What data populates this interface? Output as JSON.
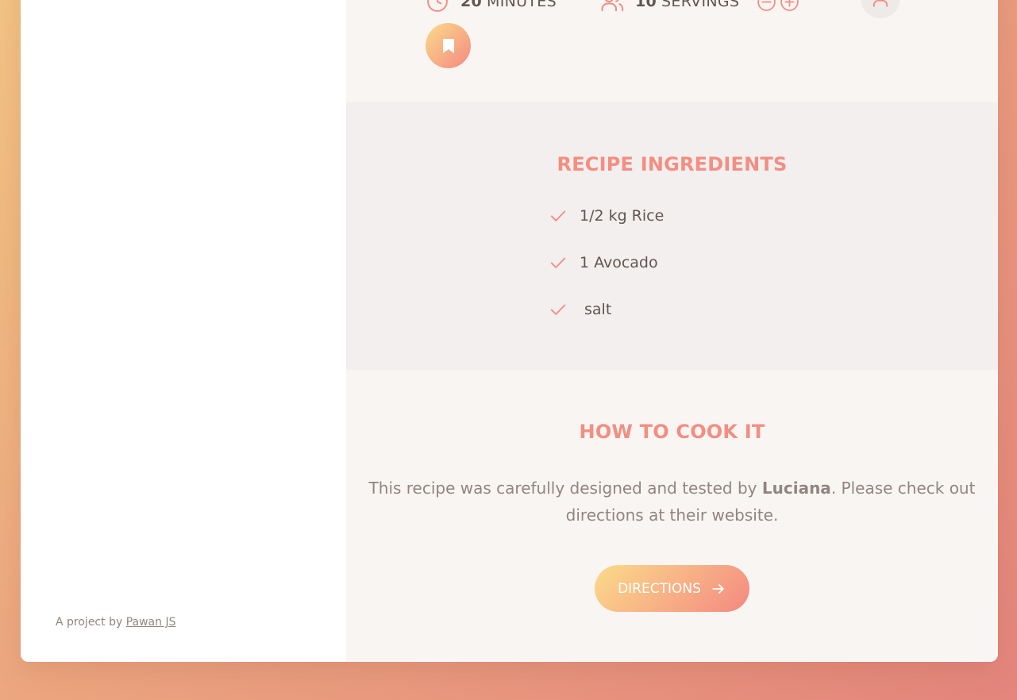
{
  "sidebar": {
    "copyright_prefix": "A project by ",
    "copyright_link": "Pawan JS"
  },
  "recipe": {
    "cooking_time": "20",
    "time_unit": "MINUTES",
    "servings": "10",
    "servings_unit": "SERVINGS",
    "icons": {
      "time": "clock-icon",
      "servings": "users-icon",
      "decrease": "minus-circle-icon",
      "increase": "plus-circle-icon",
      "user": "user-icon",
      "bookmark": "bookmark-fill-icon"
    }
  },
  "ingredients": {
    "heading": "Recipe ingredients",
    "items": [
      {
        "quantity": "1/2",
        "description": "kg Rice"
      },
      {
        "quantity": "1",
        "description": "Avocado"
      },
      {
        "quantity": "",
        "description": "salt"
      }
    ]
  },
  "directions": {
    "heading": "How to cook it",
    "text_before": "This recipe was carefully designed and tested by ",
    "publisher": "Luciana",
    "text_after": ". Please check out directions at their website.",
    "button_label": "Directions"
  },
  "colors": {
    "accent": "#f38e82",
    "gradient_start": "#fbdb89",
    "gradient_end": "#f48982",
    "text_dark": "#615551",
    "text_muted": "#918581"
  }
}
